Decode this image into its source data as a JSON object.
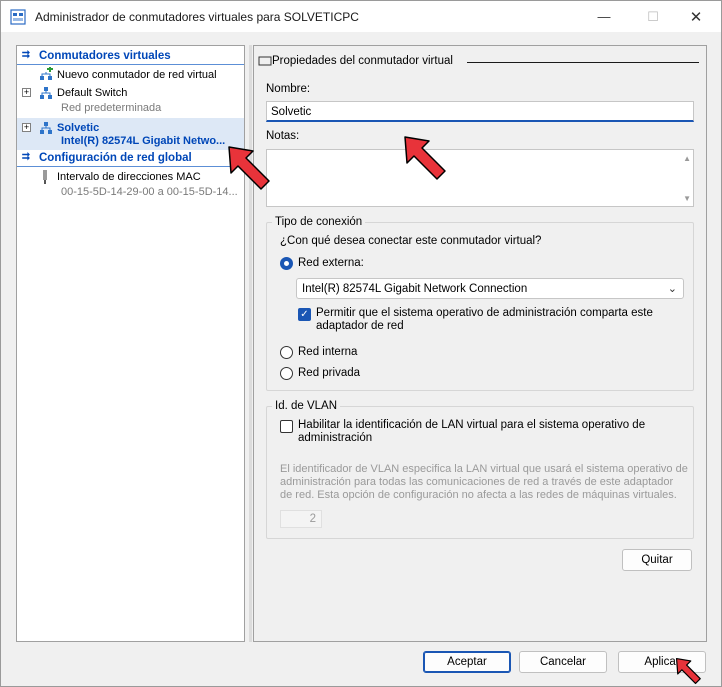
{
  "window": {
    "title": "Administrador de conmutadores virtuales para SOLVETICPC",
    "minimize": "—",
    "maximize": "☐",
    "close": "✕"
  },
  "tree": {
    "section_switches": "Conmutadores virtuales",
    "new_switch": "Nuevo conmutador de red virtual",
    "default_switch": "Default Switch",
    "default_switch_sub": "Red predeterminada",
    "solvetic": "Solvetic",
    "solvetic_sub": "Intel(R) 82574L Gigabit Netwo...",
    "section_global": "Configuración de red global",
    "mac_range": "Intervalo de direcciones MAC",
    "mac_range_sub": "00-15-5D-14-29-00 a 00-15-5D-14..."
  },
  "props": {
    "group_title": "Propiedades del conmutador virtual",
    "name_label": "Nombre:",
    "name_value": "Solvetic",
    "notes_label": "Notas:",
    "connection_legend": "Tipo de conexión",
    "connection_question": "¿Con qué desea conectar este conmutador virtual?",
    "external_label": "Red externa:",
    "adapter_value": "Intel(R) 82574L Gigabit Network Connection",
    "allow_mgmt_label_1": "Permitir que el sistema operativo de administración comparta este",
    "allow_mgmt_label_2": "adaptador de red",
    "internal_label": "Red interna",
    "private_label": "Red privada",
    "vlan_legend": "Id. de VLAN",
    "vlan_enable_1": "Habilitar la identificación de LAN virtual para el sistema operativo de",
    "vlan_enable_2": "administración",
    "vlan_desc_1": "El identificador de VLAN especifica la LAN virtual que usará el sistema operativo de",
    "vlan_desc_2": "administración para todas las comunicaciones de red a través de este adaptador",
    "vlan_desc_3": "de red. Esta opción de configuración no afecta a las redes de máquinas virtuales.",
    "vlan_id": "2",
    "remove_button": "Quitar"
  },
  "footer": {
    "ok": "Aceptar",
    "cancel": "Cancelar",
    "apply": "Aplicar"
  },
  "colors": {
    "accent": "#1a56b4",
    "selection": "#dde8f6",
    "annotation_arrow": "#e8333a"
  }
}
